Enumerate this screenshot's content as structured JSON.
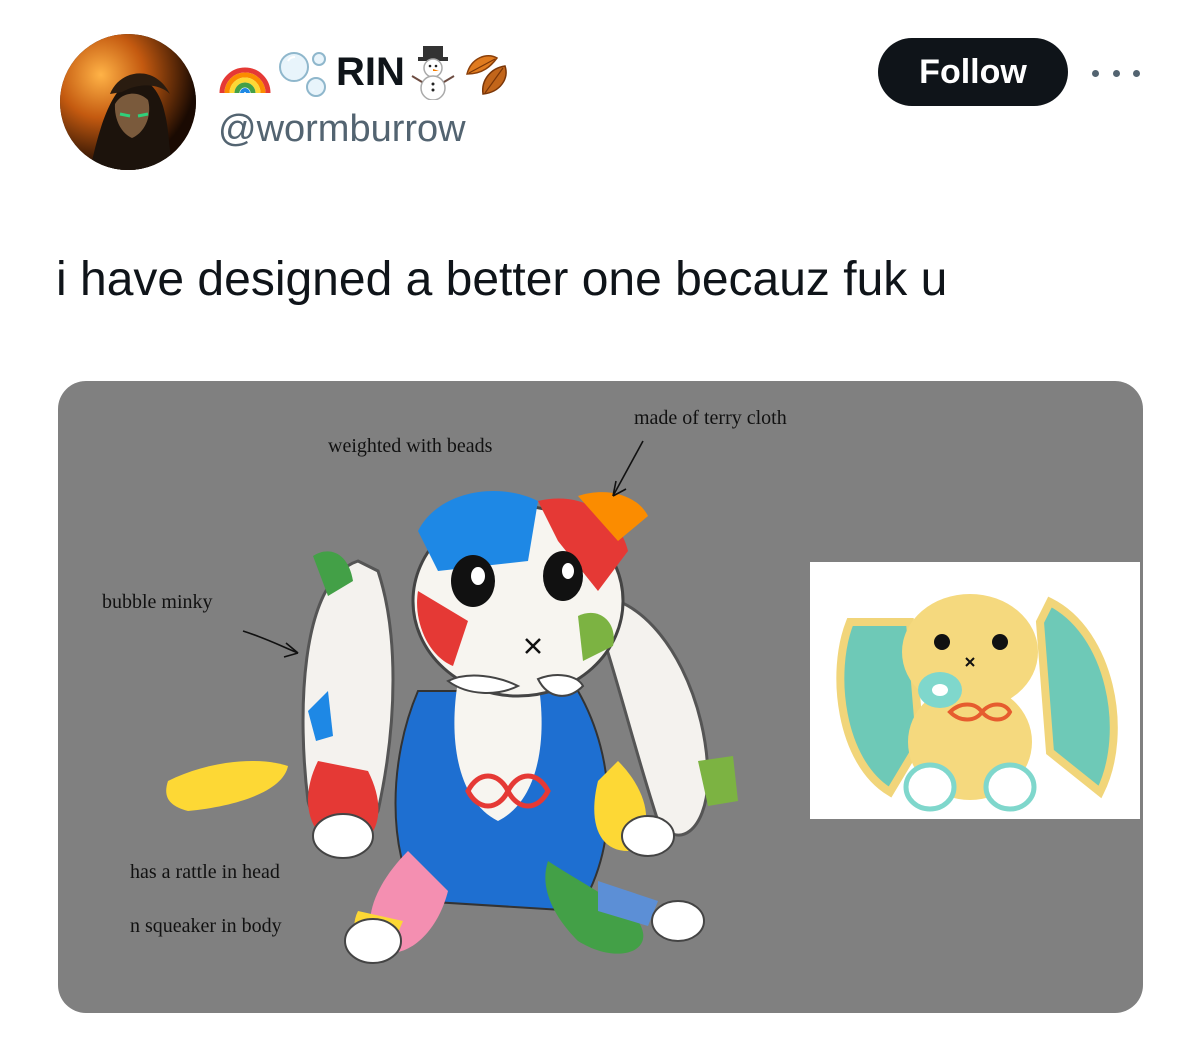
{
  "author": {
    "display_name": "RIN",
    "handle": "@wormburrow",
    "name_emojis": [
      "rainbow-icon",
      "bubbles-icon",
      "snowman-icon",
      "fallen-leaf-icon"
    ]
  },
  "actions": {
    "follow_label": "Follow"
  },
  "tweet": {
    "text": "i have designed a better one becauz fuk u"
  },
  "media": {
    "annotations": {
      "weighted": "weighted with beads",
      "terry": "made of terry cloth",
      "minky": "bubble minky",
      "rattle": "has a rattle in head",
      "squeaker": "n squeaker in body"
    }
  },
  "colors": {
    "text": "#0f1419",
    "secondary": "#536471",
    "button_bg": "#0f1419",
    "media_bg": "#808080"
  }
}
